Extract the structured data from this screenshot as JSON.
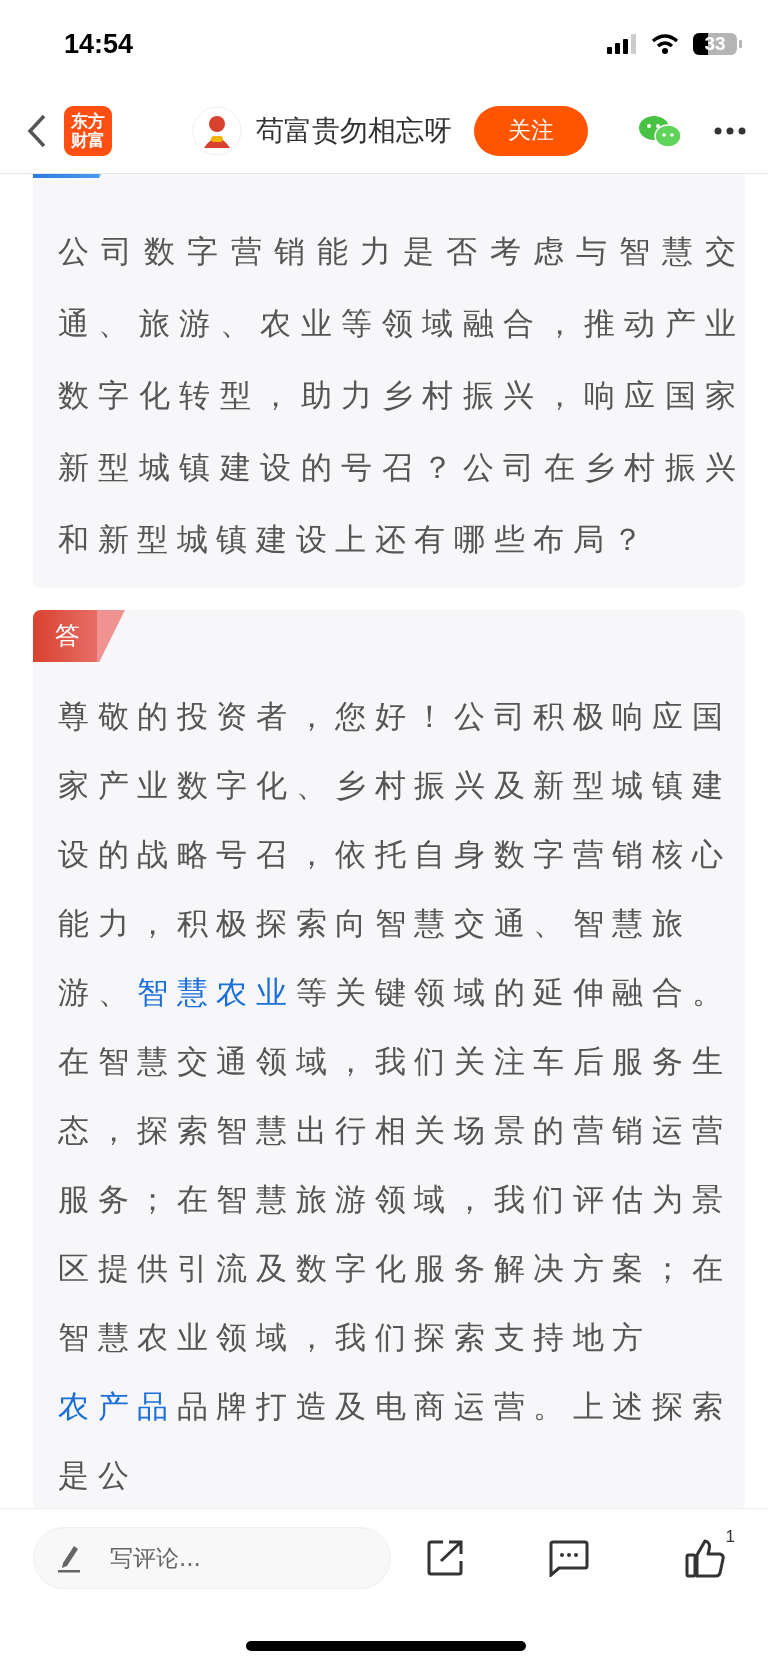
{
  "status_bar": {
    "time": "14:54",
    "battery": "33"
  },
  "nav": {
    "logo_lines": [
      "东方",
      "财富"
    ],
    "author": "苟富贵勿相忘呀",
    "follow_button": "关注"
  },
  "question": {
    "text": "公司数字营销能力是否考虑与智慧交通、旅游、农业等领域融合，推动产业数字化转型，助力乡村振兴，响应国家新型城镇建设的号召？公司在乡村振兴和新型城镇建设上还有哪些布局？"
  },
  "answer": {
    "tag": "答",
    "segments": [
      {
        "text": "尊敬的投资者，您好！公司积极响应国家产业数字化、乡村振兴及新型城镇建设的战略号召，依托自身数字营销核心能力，积极探索向智慧交通、智慧旅游、",
        "link": false
      },
      {
        "text": "智慧农业",
        "link": true
      },
      {
        "text": "等关键领域的延伸融合。在智慧交通领域，我们关注车后服务生态，探索智慧出行相关场景的营销运营服务；在智慧旅游领域，我们评估为景区提供引流及数字化服务解决方案；在智慧农业领域，我们探索支持地方",
        "link": false
      },
      {
        "text": "农产品",
        "link": true
      },
      {
        "text": "品牌打造及电商运营。上述探索是公",
        "link": false
      }
    ]
  },
  "bottom_bar": {
    "comment_placeholder": "写评论...",
    "like_count": "1"
  }
}
